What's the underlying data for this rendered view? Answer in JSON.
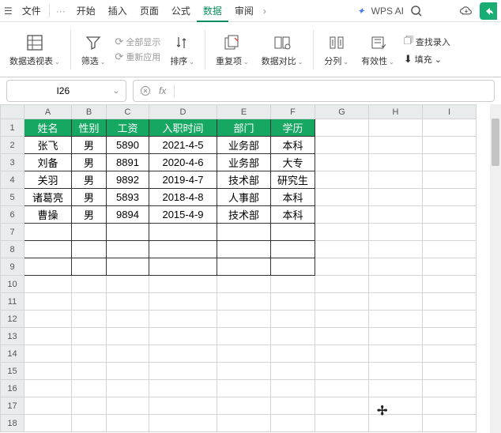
{
  "top": {
    "file": "文件",
    "more": "···",
    "tabs": [
      "开始",
      "插入",
      "页面",
      "公式",
      "数据",
      "审阅"
    ],
    "active_tab_index": 4,
    "chevron": "›",
    "ai_logo": "✦",
    "ai_text": "WPS AI"
  },
  "ribbon": {
    "pivot": "数据透视表",
    "filter": "筛选",
    "show_all": "全部显示",
    "reapply": "重新应用",
    "sort": "排序",
    "dup": "重复项",
    "compare": "数据对比",
    "split": "分列",
    "validate": "有效性",
    "fill": "填充",
    "find_entry": "查找录入",
    "arrow": "⌄"
  },
  "namebox": {
    "cell_ref": "I26",
    "fx": "fx"
  },
  "sheet": {
    "cols": [
      "A",
      "B",
      "C",
      "D",
      "E",
      "F",
      "G",
      "H",
      "I"
    ],
    "rows": [
      "1",
      "2",
      "3",
      "4",
      "5",
      "6",
      "7",
      "8",
      "9",
      "10",
      "11",
      "12",
      "13",
      "14",
      "15",
      "16",
      "17",
      "18"
    ],
    "headers": [
      "姓名",
      "性别",
      "工资",
      "入职时间",
      "部门",
      "学历"
    ],
    "data": [
      [
        "张飞",
        "男",
        "5890",
        "2021-4-5",
        "业务部",
        "本科"
      ],
      [
        "刘备",
        "男",
        "8891",
        "2020-4-6",
        "业务部",
        "大专"
      ],
      [
        "关羽",
        "男",
        "9892",
        "2019-4-7",
        "技术部",
        "研究生"
      ],
      [
        "诸葛亮",
        "男",
        "5893",
        "2018-4-8",
        "人事部",
        "本科"
      ],
      [
        "曹操",
        "男",
        "9894",
        "2015-4-9",
        "技术部",
        "本科"
      ]
    ]
  }
}
